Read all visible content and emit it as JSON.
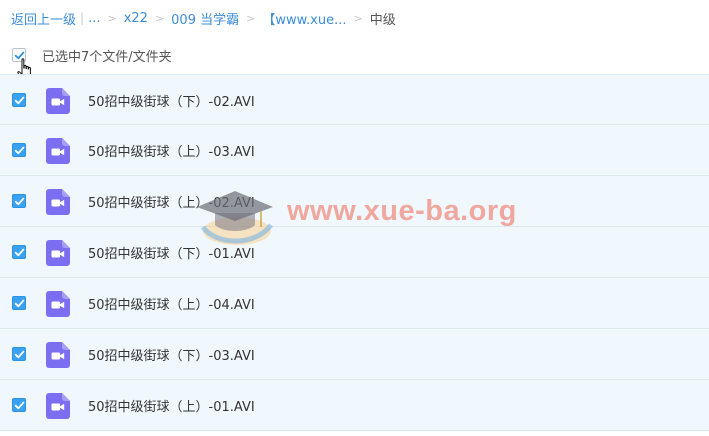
{
  "breadcrumb": {
    "back": "返回上一级",
    "ellipsis": "...",
    "items": [
      "x22",
      "009 当学霸",
      "【www.xue..."
    ],
    "current": "中级"
  },
  "selection": {
    "label": "已选中7个文件/文件夹"
  },
  "files": [
    {
      "name": "50招中级街球（下）-02.AVI",
      "checked": true
    },
    {
      "name": "50招中级街球（上）-03.AVI",
      "checked": true
    },
    {
      "name": "50招中级街球（上）-02.AVI",
      "checked": true
    },
    {
      "name": "50招中级街球（下）-01.AVI",
      "checked": true
    },
    {
      "name": "50招中级街球（上）-04.AVI",
      "checked": true
    },
    {
      "name": "50招中级街球（下）-03.AVI",
      "checked": true
    },
    {
      "name": "50招中级街球（上）-01.AVI",
      "checked": true
    }
  ],
  "watermark": {
    "text": "www.xue-ba.org"
  },
  "colors": {
    "link": "#3b8cd9",
    "checkbox": "#3aa2f0",
    "row_bg": "#f1f8fd",
    "video_icon": "#7b6ef0"
  },
  "icons": {
    "file": "video-file-icon",
    "check": "checkmark-icon"
  }
}
